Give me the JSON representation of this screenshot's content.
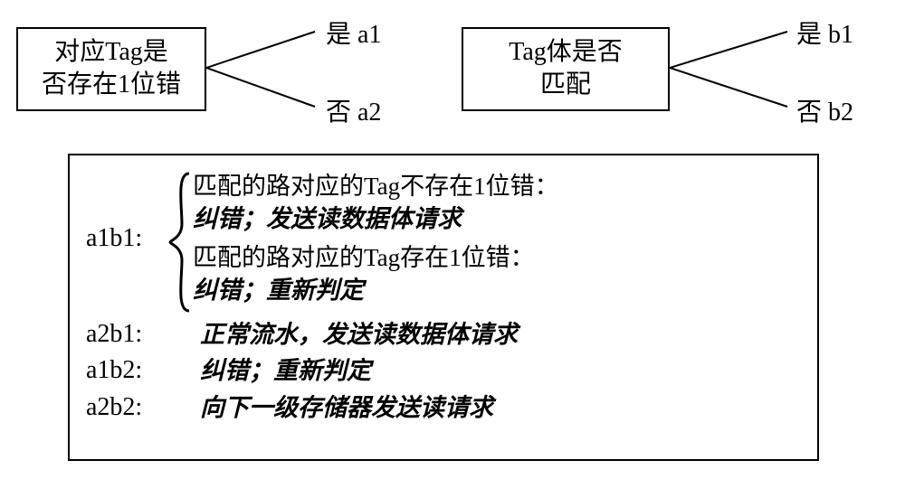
{
  "decisions": {
    "left": {
      "line1": "对应Tag是",
      "line2": "否存在1位错",
      "yes": "是 a1",
      "no": "否 a2"
    },
    "right": {
      "line1": "Tag体是否",
      "line2": "匹配",
      "yes": "是 b1",
      "no": "否 b2"
    }
  },
  "results": {
    "a1b1": {
      "label": "a1b1:",
      "case1_title": "匹配的路对应的Tag不存在1位错：",
      "case1_action": "纠错；发送读数据体请求",
      "case2_title": "匹配的路对应的Tag存在1位错：",
      "case2_action": "纠错；重新判定"
    },
    "a2b1": {
      "label": "a2b1:",
      "action": "正常流水，发送读数据体请求"
    },
    "a1b2": {
      "label": "a1b2:",
      "action": "纠错；重新判定"
    },
    "a2b2": {
      "label": "a2b2:",
      "action": "向下一级存储器发送读请求"
    }
  },
  "chart_data": {
    "type": "diagram",
    "title": "",
    "decision_nodes": [
      {
        "id": "A",
        "question": "对应Tag是否存在1位错",
        "branches": [
          {
            "answer": "是",
            "code": "a1"
          },
          {
            "answer": "否",
            "code": "a2"
          }
        ]
      },
      {
        "id": "B",
        "question": "Tag体是否匹配",
        "branches": [
          {
            "answer": "是",
            "code": "b1"
          },
          {
            "answer": "否",
            "code": "b2"
          }
        ]
      }
    ],
    "outcomes": [
      {
        "code": "a1b1",
        "subcases": [
          {
            "condition": "匹配的路对应的Tag不存在1位错",
            "action": "纠错；发送读数据体请求"
          },
          {
            "condition": "匹配的路对应的Tag存在1位错",
            "action": "纠错；重新判定"
          }
        ]
      },
      {
        "code": "a2b1",
        "action": "正常流水，发送读数据体请求"
      },
      {
        "code": "a1b2",
        "action": "纠错；重新判定"
      },
      {
        "code": "a2b2",
        "action": "向下一级存储器发送读请求"
      }
    ]
  }
}
